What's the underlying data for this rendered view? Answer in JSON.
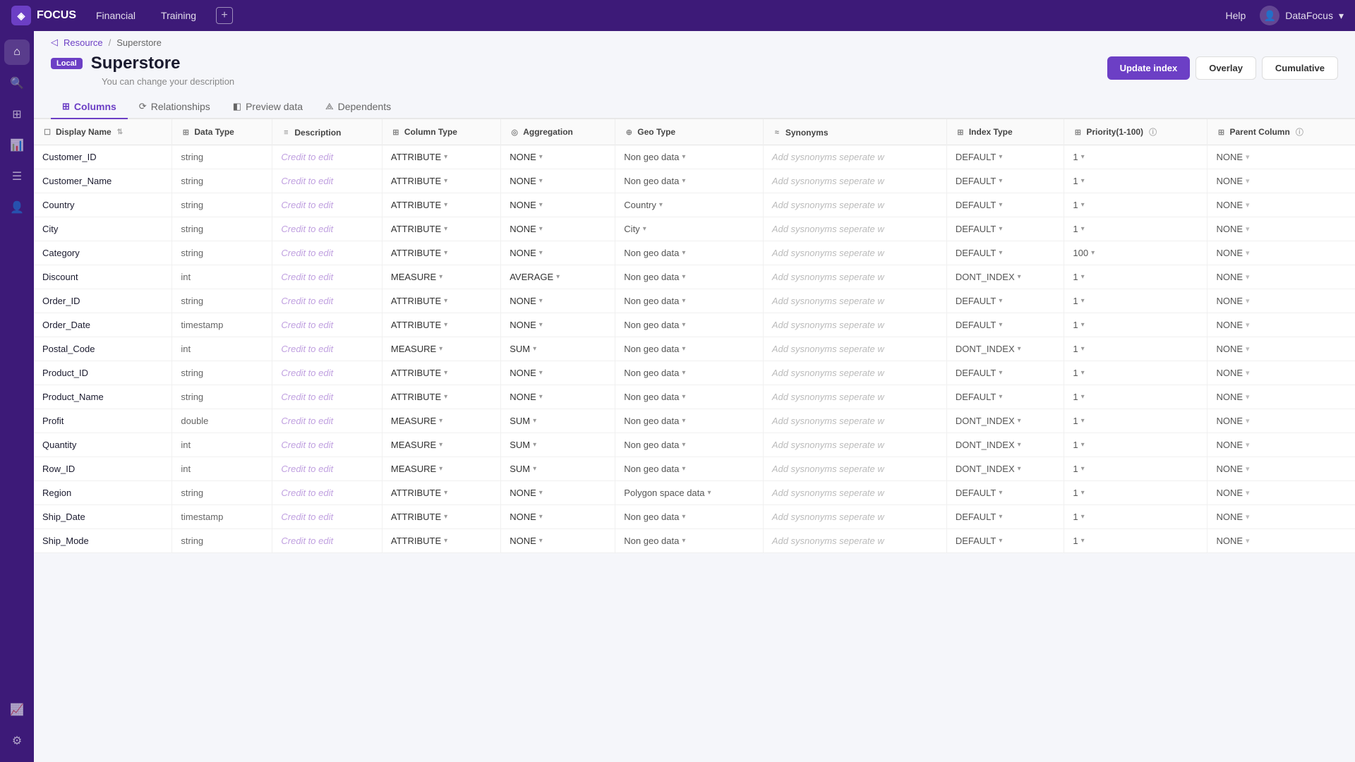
{
  "app": {
    "logo": "◈",
    "name": "FOCUS",
    "nav_items": [
      "Financial",
      "Training"
    ],
    "add_label": "+",
    "help_label": "Help",
    "user_label": "DataFocus",
    "user_icon": "👤"
  },
  "sidebar": {
    "icons": [
      {
        "name": "home-icon",
        "symbol": "⌂"
      },
      {
        "name": "search-icon",
        "symbol": "🔍"
      },
      {
        "name": "grid-icon",
        "symbol": "⊞"
      },
      {
        "name": "chart-icon",
        "symbol": "📊"
      },
      {
        "name": "list-icon",
        "symbol": "☰"
      },
      {
        "name": "user-icon",
        "symbol": "👤"
      },
      {
        "name": "activity-icon",
        "symbol": "📈"
      },
      {
        "name": "settings-icon",
        "symbol": "⚙"
      }
    ]
  },
  "breadcrumb": {
    "home": "◁",
    "resource": "Resource",
    "separator": "/",
    "current": "Superstore"
  },
  "header": {
    "badge": "Local",
    "title": "Superstore",
    "subtitle": "You can change your description",
    "buttons": {
      "update_index": "Update index",
      "overlay": "Overlay",
      "cumulative": "Cumulative"
    }
  },
  "tabs": [
    {
      "id": "columns",
      "icon": "⊞",
      "label": "Columns",
      "active": true
    },
    {
      "id": "relationships",
      "icon": "⟳",
      "label": "Relationships",
      "active": false
    },
    {
      "id": "preview-data",
      "icon": "◧",
      "label": "Preview data",
      "active": false
    },
    {
      "id": "dependents",
      "icon": "⟁",
      "label": "Dependents",
      "active": false
    }
  ],
  "table": {
    "columns": [
      {
        "id": "display-name",
        "icon": "☐",
        "label": "Display Name",
        "sortable": true
      },
      {
        "id": "data-type",
        "icon": "⊞",
        "label": "Data Type"
      },
      {
        "id": "description",
        "icon": "≡",
        "label": "Description"
      },
      {
        "id": "column-type",
        "icon": "⊞",
        "label": "Column Type"
      },
      {
        "id": "aggregation",
        "icon": "◎",
        "label": "Aggregation"
      },
      {
        "id": "geo-type",
        "icon": "⊕",
        "label": "Geo Type"
      },
      {
        "id": "synonyms",
        "icon": "≈",
        "label": "Synonyms"
      },
      {
        "id": "index-type",
        "icon": "⊞",
        "label": "Index Type"
      },
      {
        "id": "priority",
        "icon": "⊞",
        "label": "Priority(1-100)",
        "info": true
      },
      {
        "id": "parent-column",
        "icon": "⊞",
        "label": "Parent Column",
        "info": true
      }
    ],
    "rows": [
      {
        "display_name": "Customer_ID",
        "data_type": "string",
        "description": "Credit to edit",
        "column_type": "ATTRIBUTE",
        "aggregation": "NONE",
        "geo_type": "Non geo data",
        "synonyms": "Add sysnonyms seperate w",
        "index_type": "DEFAULT",
        "priority": "1",
        "parent_column": "NONE"
      },
      {
        "display_name": "Customer_Name",
        "data_type": "string",
        "description": "Credit to edit",
        "column_type": "ATTRIBUTE",
        "aggregation": "NONE",
        "geo_type": "Non geo data",
        "synonyms": "Add sysnonyms seperate w",
        "index_type": "DEFAULT",
        "priority": "1",
        "parent_column": "NONE"
      },
      {
        "display_name": "Country",
        "data_type": "string",
        "description": "Credit to edit",
        "column_type": "ATTRIBUTE",
        "aggregation": "NONE",
        "geo_type": "Country",
        "synonyms": "Add sysnonyms seperate w",
        "index_type": "DEFAULT",
        "priority": "1",
        "parent_column": "NONE"
      },
      {
        "display_name": "City",
        "data_type": "string",
        "description": "Credit to edit",
        "column_type": "ATTRIBUTE",
        "aggregation": "NONE",
        "geo_type": "City",
        "synonyms": "Add sysnonyms seperate w",
        "index_type": "DEFAULT",
        "priority": "1",
        "parent_column": "NONE"
      },
      {
        "display_name": "Category",
        "data_type": "string",
        "description": "Credit to edit",
        "column_type": "ATTRIBUTE",
        "aggregation": "NONE",
        "geo_type": "Non geo data",
        "synonyms": "Add sysnonyms seperate w",
        "index_type": "DEFAULT",
        "priority": "100",
        "parent_column": "NONE"
      },
      {
        "display_name": "Discount",
        "data_type": "int",
        "description": "Credit to edit",
        "column_type": "MEASURE",
        "aggregation": "AVERAGE",
        "geo_type": "Non geo data",
        "synonyms": "Add sysnonyms seperate w",
        "index_type": "DONT_INDEX",
        "priority": "1",
        "parent_column": "NONE"
      },
      {
        "display_name": "Order_ID",
        "data_type": "string",
        "description": "Credit to edit",
        "column_type": "ATTRIBUTE",
        "aggregation": "NONE",
        "geo_type": "Non geo data",
        "synonyms": "Add sysnonyms seperate w",
        "index_type": "DEFAULT",
        "priority": "1",
        "parent_column": "NONE"
      },
      {
        "display_name": "Order_Date",
        "data_type": "timestamp",
        "description": "Credit to edit",
        "column_type": "ATTRIBUTE",
        "aggregation": "NONE",
        "geo_type": "Non geo data",
        "synonyms": "Add sysnonyms seperate w",
        "index_type": "DEFAULT",
        "priority": "1",
        "parent_column": "NONE"
      },
      {
        "display_name": "Postal_Code",
        "data_type": "int",
        "description": "Credit to edit",
        "column_type": "MEASURE",
        "aggregation": "SUM",
        "geo_type": "Non geo data",
        "synonyms": "Add sysnonyms seperate w",
        "index_type": "DONT_INDEX",
        "priority": "1",
        "parent_column": "NONE"
      },
      {
        "display_name": "Product_ID",
        "data_type": "string",
        "description": "Credit to edit",
        "column_type": "ATTRIBUTE",
        "aggregation": "NONE",
        "geo_type": "Non geo data",
        "synonyms": "Add sysnonyms seperate w",
        "index_type": "DEFAULT",
        "priority": "1",
        "parent_column": "NONE"
      },
      {
        "display_name": "Product_Name",
        "data_type": "string",
        "description": "Credit to edit",
        "column_type": "ATTRIBUTE",
        "aggregation": "NONE",
        "geo_type": "Non geo data",
        "synonyms": "Add sysnonyms seperate w",
        "index_type": "DEFAULT",
        "priority": "1",
        "parent_column": "NONE"
      },
      {
        "display_name": "Profit",
        "data_type": "double",
        "description": "Credit to edit",
        "column_type": "MEASURE",
        "aggregation": "SUM",
        "geo_type": "Non geo data",
        "synonyms": "Add sysnonyms seperate w",
        "index_type": "DONT_INDEX",
        "priority": "1",
        "parent_column": "NONE"
      },
      {
        "display_name": "Quantity",
        "data_type": "int",
        "description": "Credit to edit",
        "column_type": "MEASURE",
        "aggregation": "SUM",
        "geo_type": "Non geo data",
        "synonyms": "Add sysnonyms seperate w",
        "index_type": "DONT_INDEX",
        "priority": "1",
        "parent_column": "NONE"
      },
      {
        "display_name": "Row_ID",
        "data_type": "int",
        "description": "Credit to edit",
        "column_type": "MEASURE",
        "aggregation": "SUM",
        "geo_type": "Non geo data",
        "synonyms": "Add sysnonyms seperate w",
        "index_type": "DONT_INDEX",
        "priority": "1",
        "parent_column": "NONE"
      },
      {
        "display_name": "Region",
        "data_type": "string",
        "description": "Credit to edit",
        "column_type": "ATTRIBUTE",
        "aggregation": "NONE",
        "geo_type": "Polygon space data",
        "synonyms": "Add sysnonyms seperate w",
        "index_type": "DEFAULT",
        "priority": "1",
        "parent_column": "NONE"
      },
      {
        "display_name": "Ship_Date",
        "data_type": "timestamp",
        "description": "Credit to edit",
        "column_type": "ATTRIBUTE",
        "aggregation": "NONE",
        "geo_type": "Non geo data",
        "synonyms": "Add sysnonyms seperate w",
        "index_type": "DEFAULT",
        "priority": "1",
        "parent_column": "NONE"
      },
      {
        "display_name": "Ship_Mode",
        "data_type": "string",
        "description": "Credit to edit",
        "column_type": "ATTRIBUTE",
        "aggregation": "NONE",
        "geo_type": "Non geo data",
        "synonyms": "Add sysnonyms seperate w",
        "index_type": "DEFAULT",
        "priority": "1",
        "parent_column": "NONE"
      }
    ]
  }
}
